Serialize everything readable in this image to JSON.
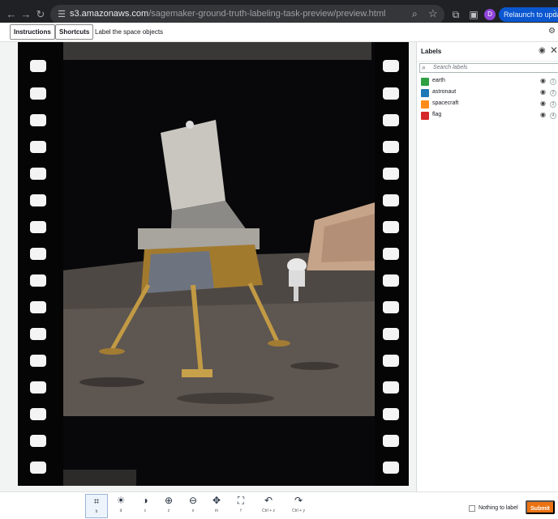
{
  "browser": {
    "url_host": "s3.amazonaws.com",
    "url_path": "/sagemaker-ground-truth-labeling-task-preview/preview.html",
    "profile_initial": "D",
    "relaunch_label": "Relaunch to update"
  },
  "header": {
    "instructions_label": "Instructions",
    "shortcuts_label": "Shortcuts",
    "task_title": "Label the space objects"
  },
  "labels_panel": {
    "title": "Labels",
    "search_placeholder": "Search labels",
    "items": [
      {
        "name": "earth",
        "color": "#2ea043",
        "key": "1"
      },
      {
        "name": "astronaut",
        "color": "#1f77b4",
        "key": "2"
      },
      {
        "name": "spacecraft",
        "color": "#ff8c1a",
        "key": "3"
      },
      {
        "name": "flag",
        "color": "#d62728",
        "key": "4"
      }
    ]
  },
  "tools": [
    {
      "name": "bounding-box",
      "key": "b",
      "icon": "bounding-box-icon",
      "active": true
    },
    {
      "name": "brightness",
      "key": "d",
      "icon": "brightness-icon"
    },
    {
      "name": "contrast",
      "key": "c",
      "icon": "contrast-icon"
    },
    {
      "name": "zoom-in",
      "key": "z",
      "icon": "zoom-in-icon"
    },
    {
      "name": "zoom-out",
      "key": "o",
      "icon": "zoom-out-icon"
    },
    {
      "name": "move",
      "key": "m",
      "icon": "move-icon"
    },
    {
      "name": "fit",
      "key": "f",
      "icon": "fit-icon"
    },
    {
      "name": "undo",
      "key": "Ctrl + z",
      "icon": "undo-icon"
    },
    {
      "name": "redo",
      "key": "Ctrl + y",
      "icon": "redo-icon"
    }
  ],
  "footer": {
    "nothing_label": "Nothing to label",
    "submit_label": "Submit"
  }
}
